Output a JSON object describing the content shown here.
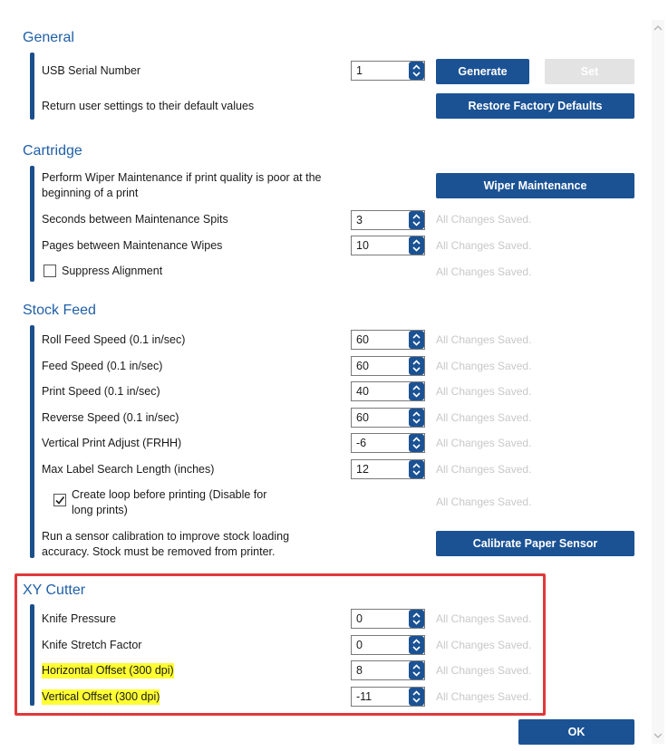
{
  "general": {
    "title": "General",
    "usb_label": "USB Serial Number",
    "usb_value": "1",
    "generate_label": "Generate",
    "set_label": "Set",
    "restore_text": "Return user settings to their default values",
    "restore_label": "Restore Factory Defaults"
  },
  "cartridge": {
    "title": "Cartridge",
    "wiper_text_1": "Perform Wiper Maintenance if print quality is poor at the",
    "wiper_text_2": "beginning of a print",
    "wiper_label": "Wiper Maintenance",
    "spits_label": "Seconds between Maintenance Spits",
    "spits_value": "3",
    "wipes_label": "Pages between Maintenance Wipes",
    "wipes_value": "10",
    "suppress_label": "Suppress Alignment",
    "suppress_checked": false
  },
  "stock_feed": {
    "title": "Stock Feed",
    "rows": [
      {
        "label": "Roll Feed Speed (0.1 in/sec)",
        "value": "60"
      },
      {
        "label": "Feed Speed (0.1 in/sec)",
        "value": "60"
      },
      {
        "label": "Print Speed (0.1 in/sec)",
        "value": "40"
      },
      {
        "label": "Reverse Speed (0.1 in/sec)",
        "value": "60"
      },
      {
        "label": "Vertical Print Adjust (FRHH)",
        "value": "-6"
      },
      {
        "label": "Max Label Search Length (inches)",
        "value": "12"
      }
    ],
    "loop_label_1": "Create loop before printing (Disable for",
    "loop_label_2": "long prints)",
    "loop_checked": true,
    "calib_text_1": "Run a sensor calibration to improve stock loading",
    "calib_text_2": "accuracy. Stock must be removed from printer.",
    "calib_label": "Calibrate Paper Sensor"
  },
  "xy_cutter": {
    "title": "XY Cutter",
    "rows": [
      {
        "label": "Knife Pressure",
        "value": "0"
      },
      {
        "label": "Knife Stretch Factor",
        "value": "0"
      },
      {
        "label": "Horizontal Offset (300 dpi)",
        "value": "8"
      },
      {
        "label": "Vertical Offset (300 dpi)",
        "value": "-11"
      }
    ]
  },
  "saved_text": "All Changes Saved.",
  "ok_label": "OK",
  "colors": {
    "accent": "#1b5294",
    "title_blue": "#1f5fa8",
    "highlight": "#ffff33",
    "annotation_red": "#e0383a"
  }
}
